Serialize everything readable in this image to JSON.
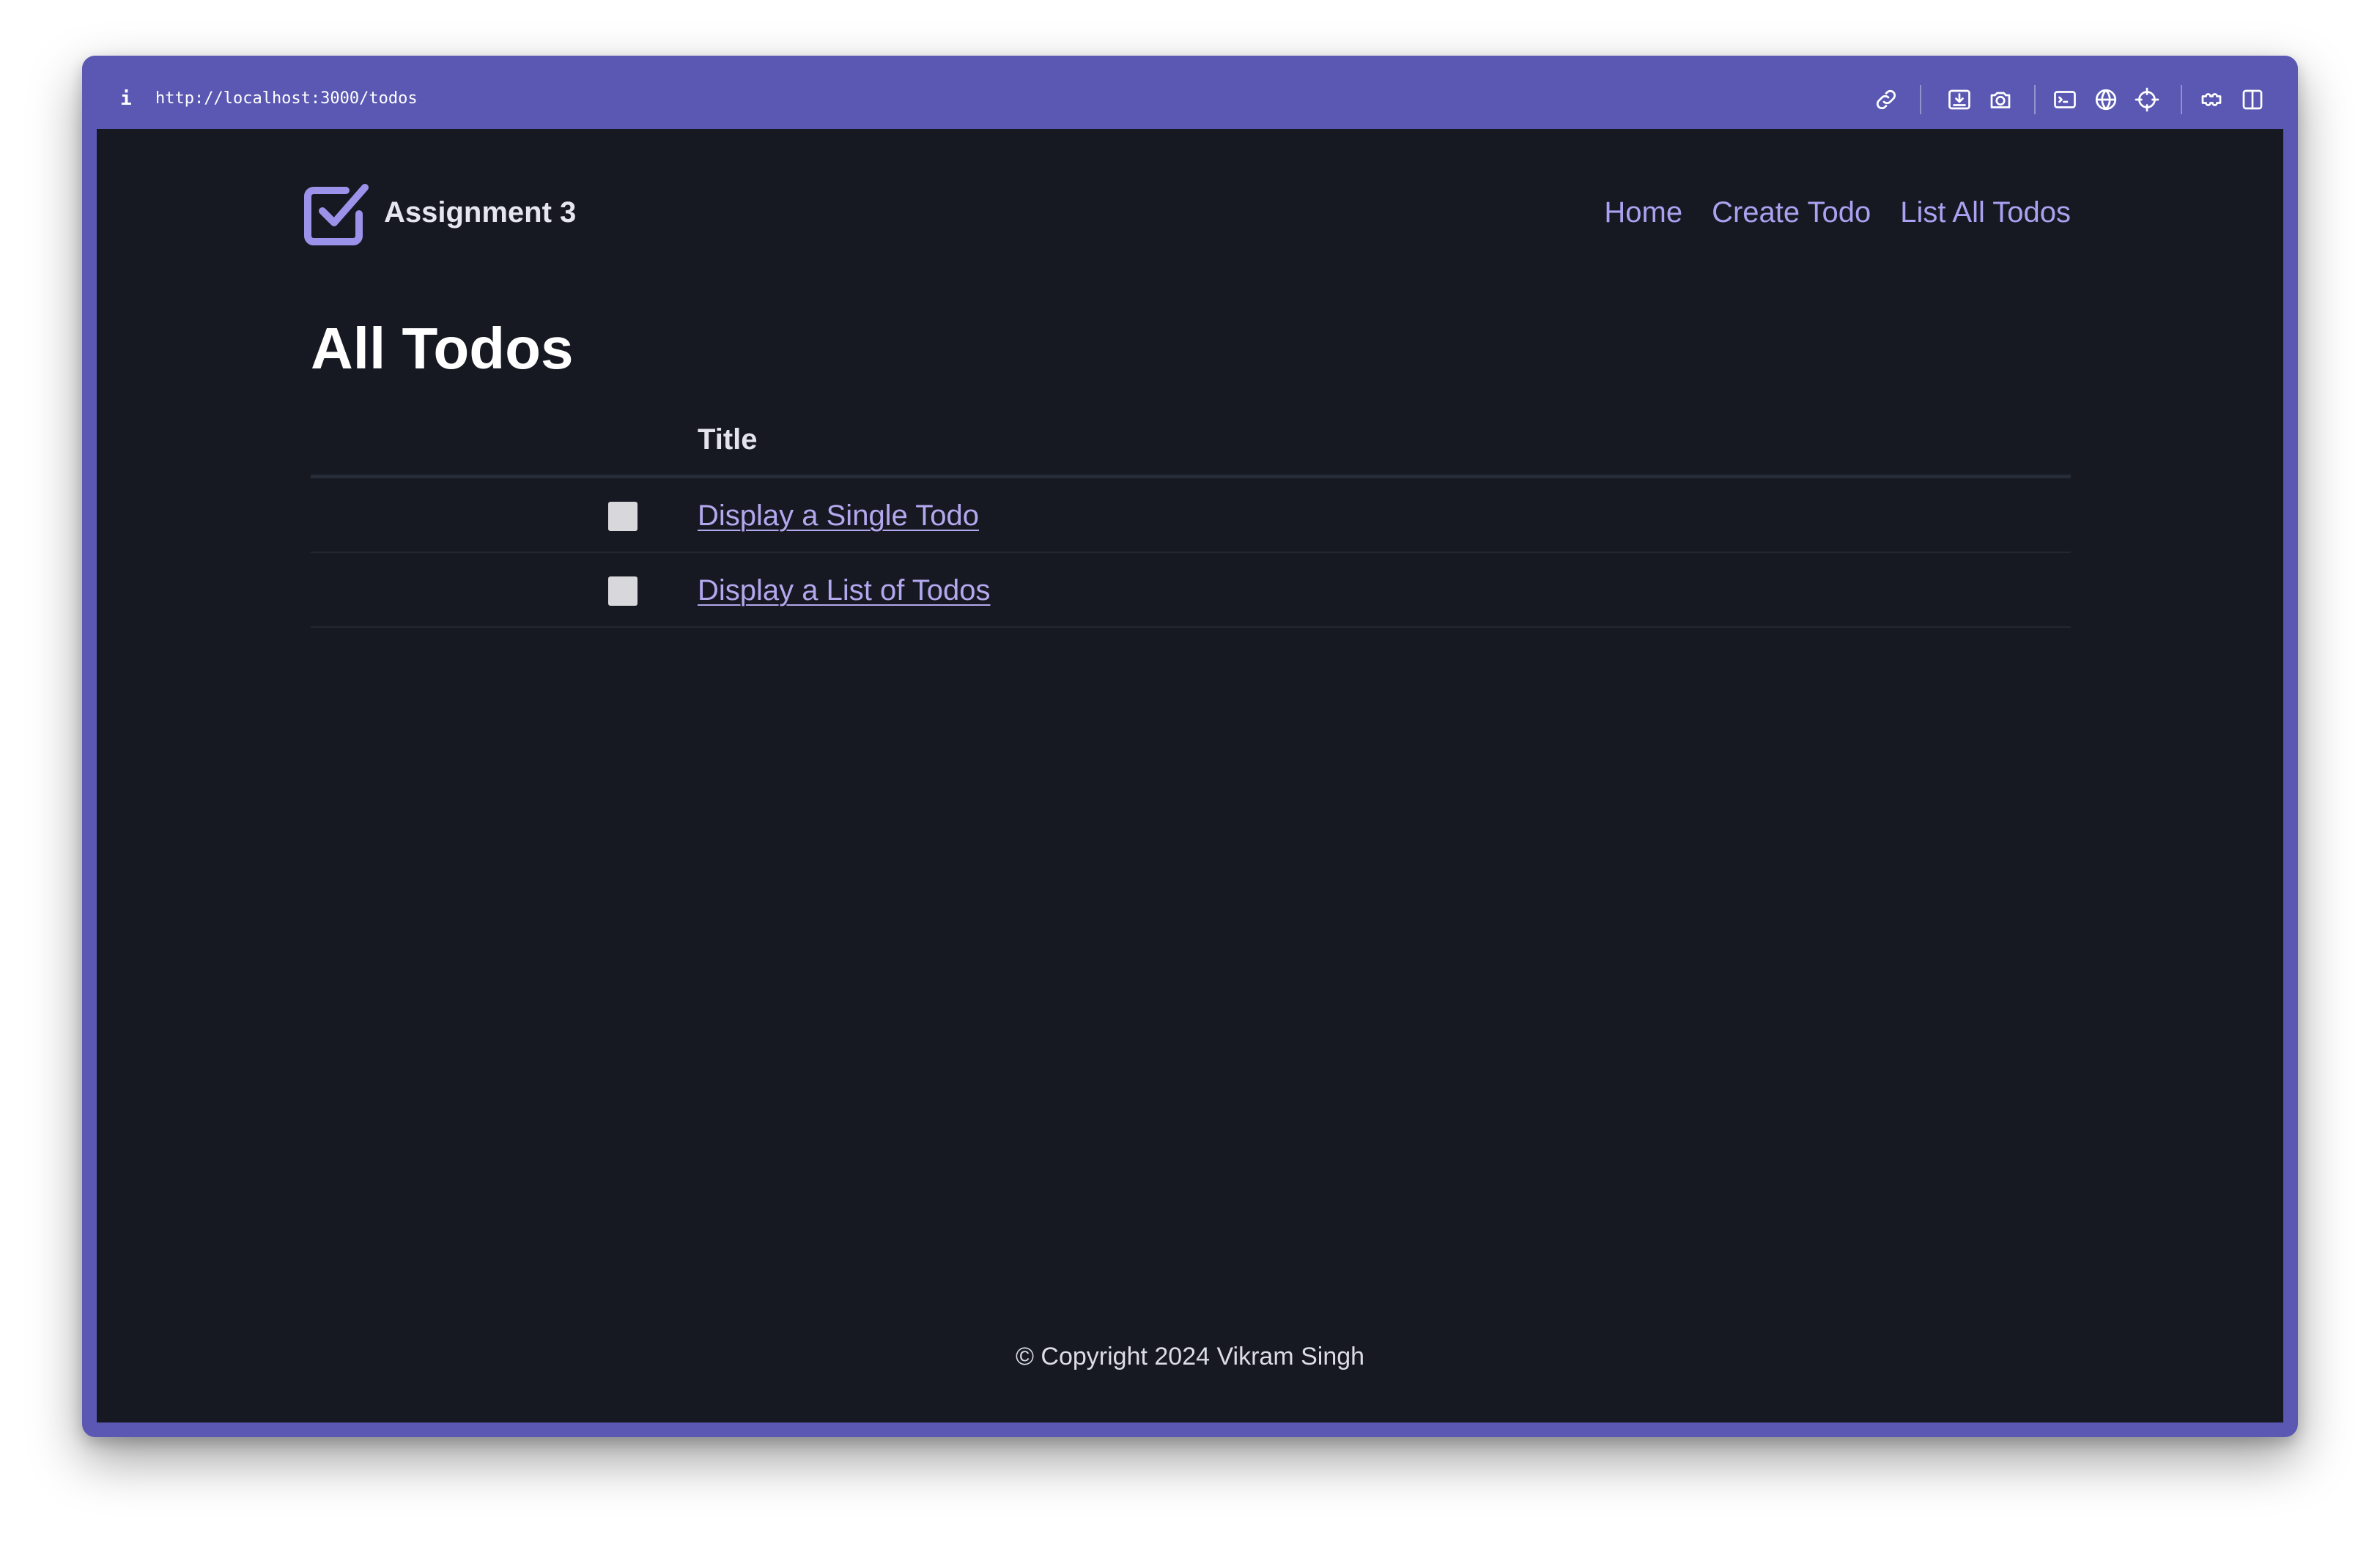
{
  "browser": {
    "url": "http://localhost:3000/todos",
    "info_glyph": "i",
    "toolbar_icons": [
      "link-icon",
      "download-icon",
      "camera-icon",
      "terminal-icon",
      "globe-icon",
      "crosshair-icon",
      "extension-icon",
      "sidebar-icon"
    ],
    "accent_color": "#5a58b3"
  },
  "header": {
    "brand": "Assignment 3",
    "brand_icon": "checkbox-checked-icon",
    "nav": {
      "home": "Home",
      "create": "Create Todo",
      "list": "List All Todos"
    }
  },
  "main": {
    "title": "All Todos",
    "table": {
      "header_title": "Title",
      "rows": [
        {
          "title": "Display a Single Todo",
          "completed": false
        },
        {
          "title": "Display a List of Todos",
          "completed": false
        }
      ]
    }
  },
  "footer": {
    "text": "© Copyright 2024 Vikram Singh"
  },
  "colors": {
    "background": "#161922",
    "link": "#a9a2f0",
    "brand_icon": "#9b92ea"
  }
}
